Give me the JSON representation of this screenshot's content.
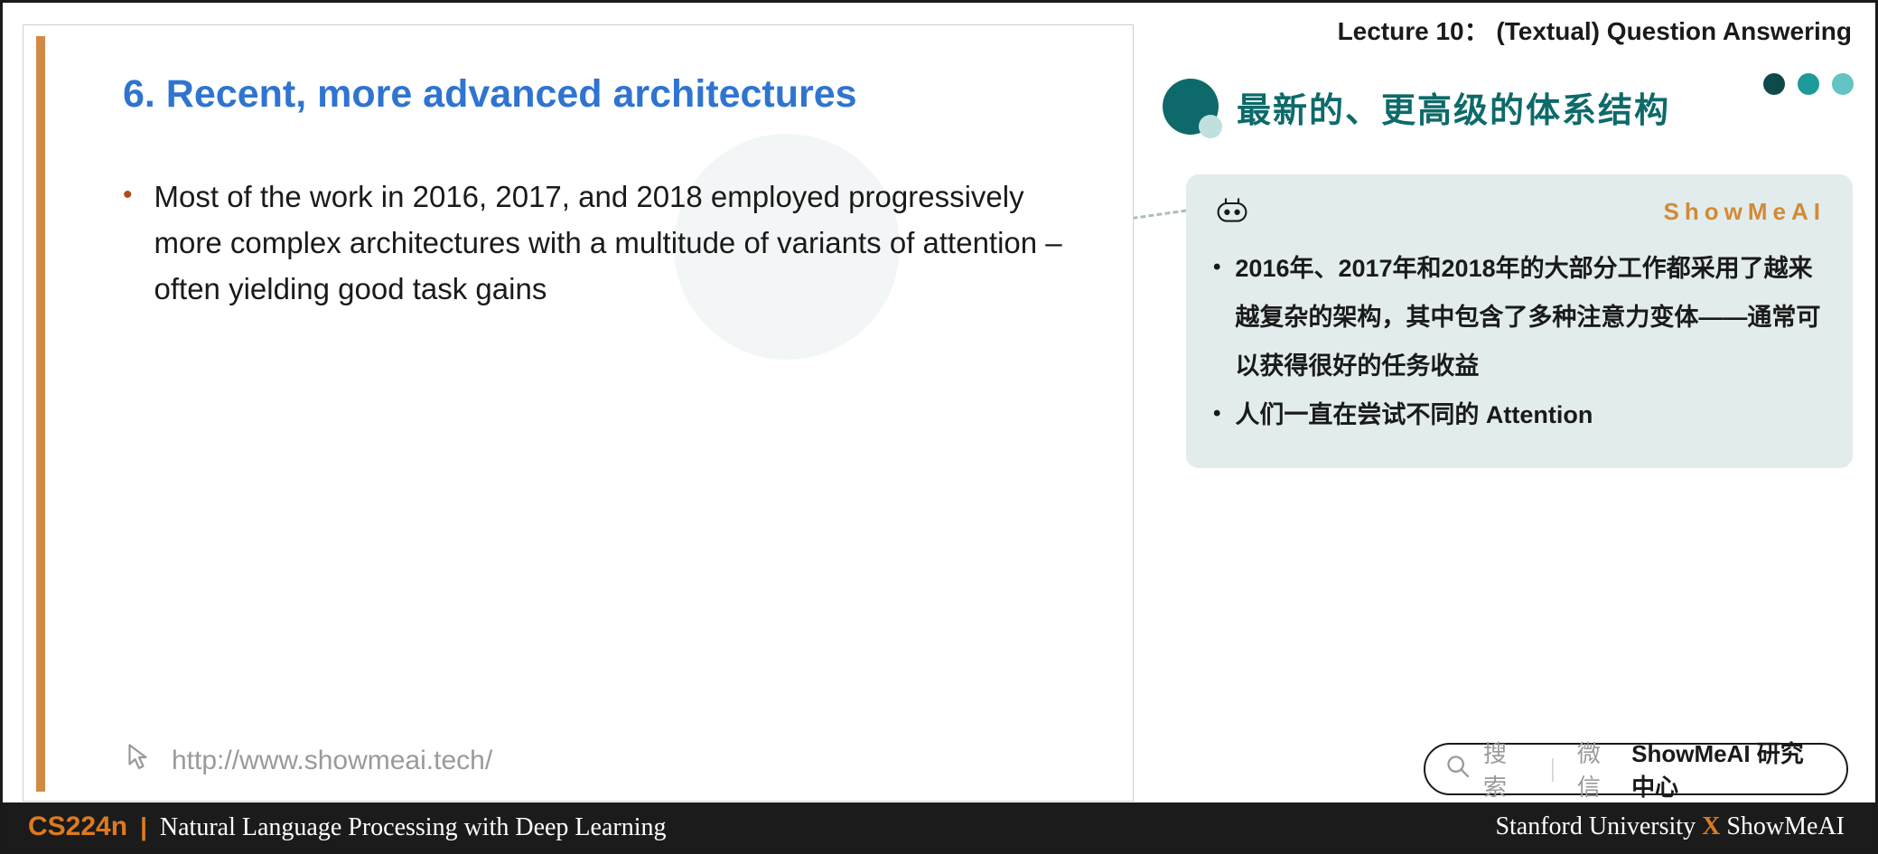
{
  "header": {
    "lecture_label": "Lecture 10： (Textual) Question Answering"
  },
  "slide": {
    "title": "6. Recent, more advanced architectures",
    "bullet1": "Most of the work in 2016, 2017, and 2018 employed progressively more complex architectures with a multitude of variants of attention – often yielding good task gains",
    "link": "http://www.showmeai.tech/"
  },
  "right": {
    "title": "最新的、更高级的体系结构",
    "brand": "ShowMeAI",
    "items": [
      "2016年、2017年和2018年的大部分工作都采用了越来越复杂的架构，其中包含了多种注意力变体——通常可以获得很好的任务收益",
      "人们一直在尝试不同的 Attention"
    ]
  },
  "search": {
    "hint": "搜索",
    "wx": "微信",
    "strong": "ShowMeAI 研究中心"
  },
  "footer": {
    "course": "CS224n",
    "subtitle": "Natural Language Processing with Deep Learning",
    "right_a": "Stanford University",
    "right_x": "X",
    "right_b": "ShowMeAI"
  }
}
